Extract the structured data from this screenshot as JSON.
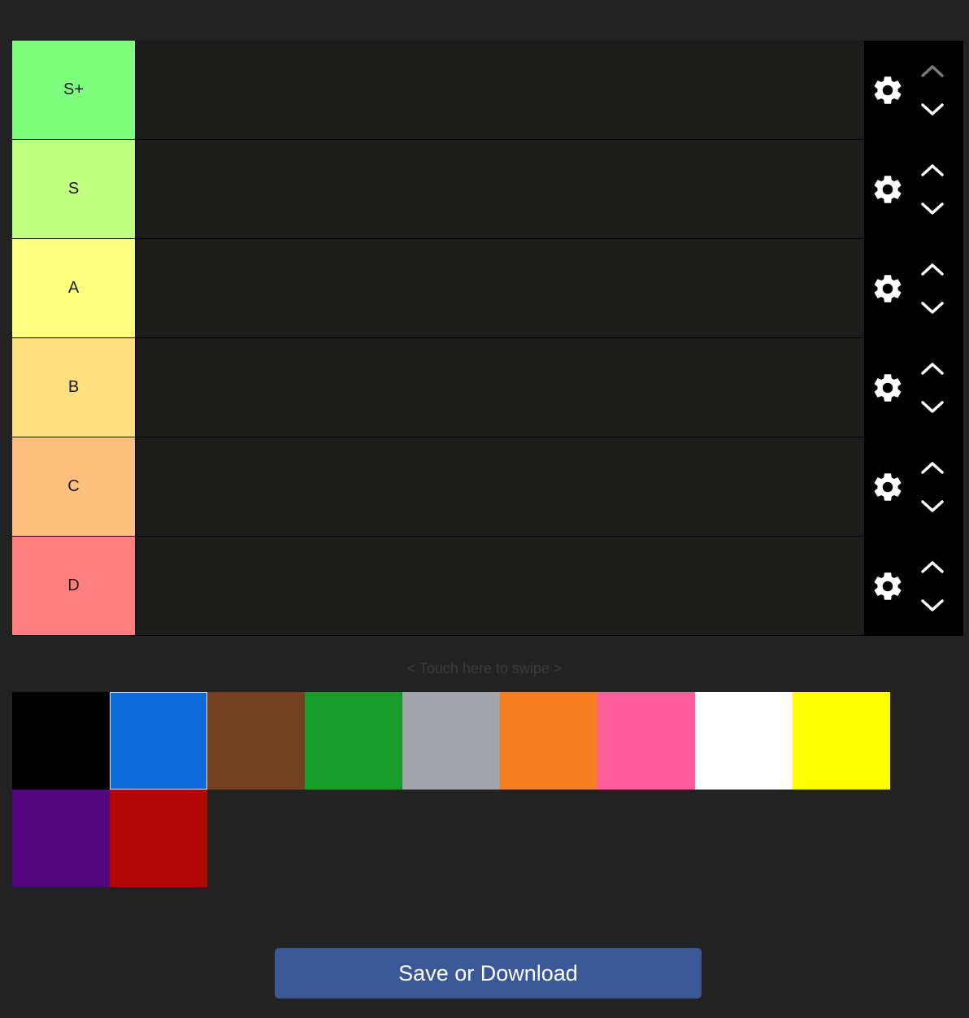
{
  "tiers": [
    {
      "label": "S+",
      "color": "#80ff7f",
      "up_enabled": false
    },
    {
      "label": "S",
      "color": "#c0ff7f",
      "up_enabled": true
    },
    {
      "label": "A",
      "color": "#ffff7f",
      "up_enabled": true
    },
    {
      "label": "B",
      "color": "#ffdf80",
      "up_enabled": true
    },
    {
      "label": "C",
      "color": "#ffbf7f",
      "up_enabled": true
    },
    {
      "label": "D",
      "color": "#ff7f7f",
      "up_enabled": true
    }
  ],
  "controls": {
    "settings_icon": "gear-icon",
    "move_up_icon": "chevron-up-icon",
    "move_down_icon": "chevron-down-icon"
  },
  "swipe_hint": "< Touch here to swipe >",
  "palette": [
    {
      "name": "black",
      "color": "#000000"
    },
    {
      "name": "blue",
      "color": "#0c69d7",
      "selected": true
    },
    {
      "name": "brown",
      "color": "#734122"
    },
    {
      "name": "green",
      "color": "#169c2a"
    },
    {
      "name": "gray",
      "color": "#a1a4aa"
    },
    {
      "name": "orange",
      "color": "#f57f21"
    },
    {
      "name": "pink",
      "color": "#ff5c9a"
    },
    {
      "name": "white",
      "color": "#ffffff"
    },
    {
      "name": "yellow",
      "color": "#ffff00"
    },
    {
      "name": "purple",
      "color": "#52057f"
    },
    {
      "name": "red",
      "color": "#b20505"
    }
  ],
  "save_button_label": "Save or Download"
}
